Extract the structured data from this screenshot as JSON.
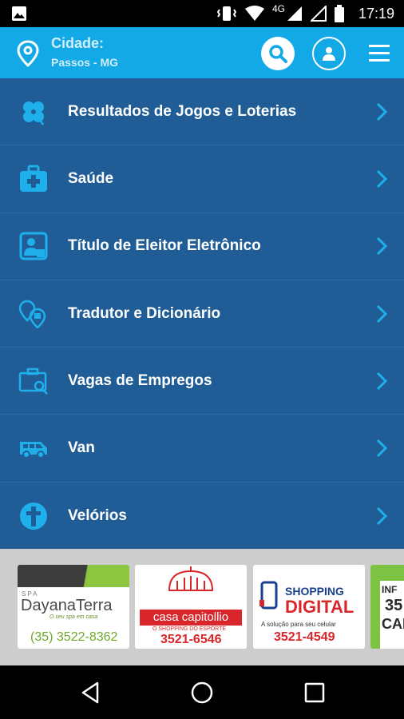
{
  "status_bar": {
    "time": "17:19",
    "network": "4G",
    "icons": [
      "image-icon",
      "vibrate-icon",
      "wifi-icon",
      "signal-icon",
      "signal-icon",
      "battery-icon"
    ]
  },
  "header": {
    "city_label": "Cidade:",
    "city_value": "Passos - MG",
    "icons": [
      "location-pin-icon",
      "search-icon",
      "user-icon",
      "hamburger-menu-icon"
    ]
  },
  "menu": {
    "items": [
      {
        "label": "Resultados de Jogos e Loterias",
        "icon": "clover-icon"
      },
      {
        "label": "Saúde",
        "icon": "medical-kit-icon"
      },
      {
        "label": "Título de Eleitor Eletrônico",
        "icon": "voter-card-icon"
      },
      {
        "label": "Tradutor e Dicionário",
        "icon": "translate-icon"
      },
      {
        "label": "Vagas de Empregos",
        "icon": "job-search-icon"
      },
      {
        "label": "Van",
        "icon": "van-icon"
      },
      {
        "label": "Velórios",
        "icon": "cross-icon"
      }
    ]
  },
  "ads": [
    {
      "brand_top": "SPA",
      "brand": "DayanaTerra",
      "tagline": "O seu spa em casa",
      "phone": "(35) 3522-8362"
    },
    {
      "brand": "casa capitollio",
      "tagline": "O SHOPPING DO ESPORTE",
      "phone": "3521-6546"
    },
    {
      "brand_top": "SHOPPING",
      "brand": "DIGITAL",
      "tagline": "A solução para seu celular",
      "phone": "3521-4549"
    },
    {
      "brand_top": "INF",
      "brand": "CAR",
      "phone": "35"
    }
  ],
  "colors": {
    "header_bg": "#13a9e6",
    "menu_bg": "#205d96",
    "accent_icon": "#1fb0ec",
    "ad_strip_bg": "#cdcdcd"
  },
  "nav_bar": {
    "icons": [
      "back-icon",
      "home-icon",
      "recents-icon"
    ]
  }
}
